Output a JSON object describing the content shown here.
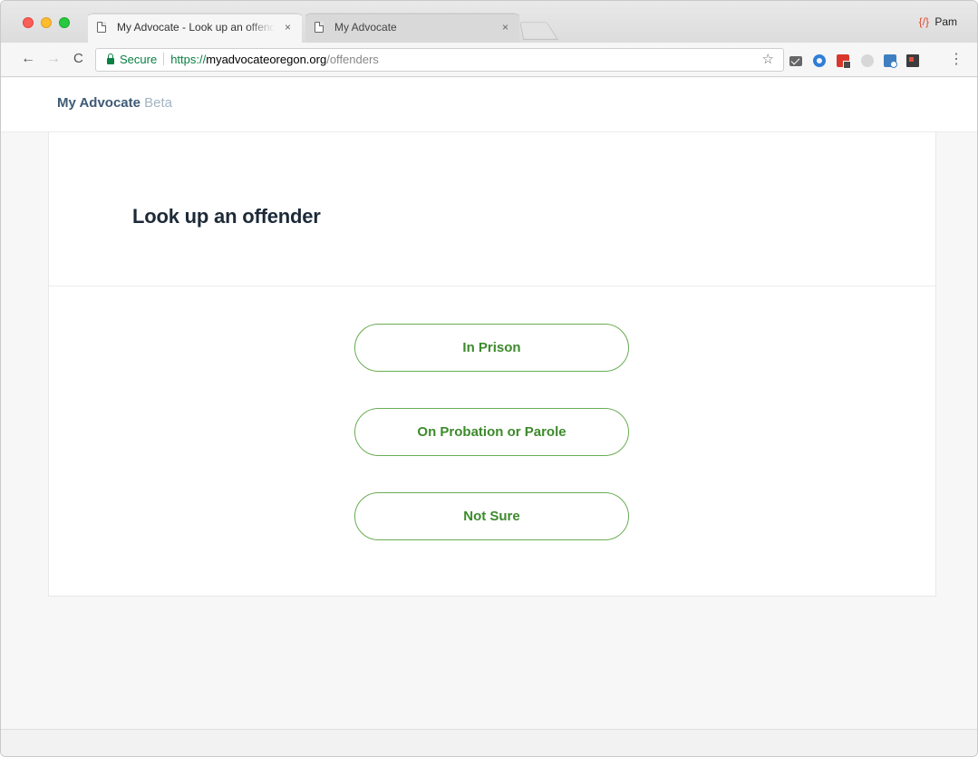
{
  "browser": {
    "tabs": [
      {
        "title": "My Advocate - Look up an offender",
        "close": "×"
      },
      {
        "title": "My Advocate",
        "close": "×"
      }
    ],
    "profile_name": "Pam",
    "profile_icon": "{/}",
    "nav": {
      "back": "←",
      "forward": "→",
      "reload": "C",
      "menu": "⋮",
      "star": "☆"
    },
    "security_label": "Secure",
    "url": {
      "scheme": "https://",
      "host": "myadvocateoregon.org",
      "path": "/offenders"
    },
    "extension_icons": [
      "mail-icon",
      "circle-icon",
      "red-extension-icon",
      "gray-extension-icon",
      "blue-extension-icon",
      "dark-extension-icon"
    ]
  },
  "site": {
    "brand": "My Advocate",
    "brand_suffix": "Beta"
  },
  "main": {
    "title": "Look up an offender",
    "options": [
      "In Prison",
      "On Probation or Parole",
      "Not Sure"
    ]
  },
  "colors": {
    "accent_green": "#3d8a2c",
    "button_border": "#6aad55",
    "brand_blue": "#3e5a76",
    "title_dark": "#1d2a38"
  }
}
